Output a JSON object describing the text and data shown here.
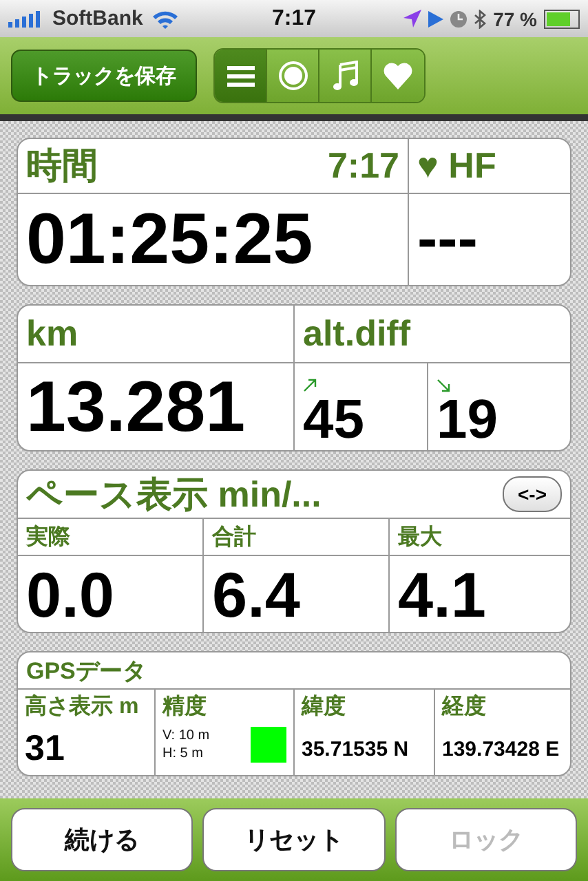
{
  "status_bar": {
    "carrier": "SoftBank",
    "time": "7:17",
    "battery": "77 %"
  },
  "toolbar": {
    "save_button": "トラックを保存",
    "segments": [
      {
        "kind": "list",
        "selected": true
      },
      {
        "kind": "record",
        "selected": false
      },
      {
        "kind": "music",
        "selected": false
      },
      {
        "kind": "heart",
        "selected": false
      }
    ]
  },
  "time_panel": {
    "title": "時間",
    "clock": "7:17",
    "hf_label": "♥ HF",
    "value": "01:25:25",
    "hf_value": "---"
  },
  "distance_panel": {
    "title": "km",
    "value": "13.281",
    "alt_title": "alt.diff",
    "ascent": "45",
    "descent": "19"
  },
  "pace_panel": {
    "title": "ペース表示 min/...",
    "toggle": "<->",
    "columns": [
      {
        "label": "実際",
        "value": "0.0"
      },
      {
        "label": "合計",
        "value": "6.4"
      },
      {
        "label": "最大",
        "value": "4.1"
      }
    ]
  },
  "gps_panel": {
    "title": "GPSデータ",
    "altitude": {
      "label": "高さ表示 m",
      "value": "31"
    },
    "accuracy": {
      "label": "精度",
      "vertical": "V: 10 m",
      "horizontal": "H: 5 m",
      "color": "#00ff00"
    },
    "latitude": {
      "label": "緯度",
      "value": "35.71535 N"
    },
    "longitude": {
      "label": "経度",
      "value": "139.73428 E"
    }
  },
  "buttons": [
    {
      "label": "続ける",
      "disabled": false
    },
    {
      "label": "リセット",
      "disabled": false
    },
    {
      "label": "ロック",
      "disabled": true
    }
  ]
}
